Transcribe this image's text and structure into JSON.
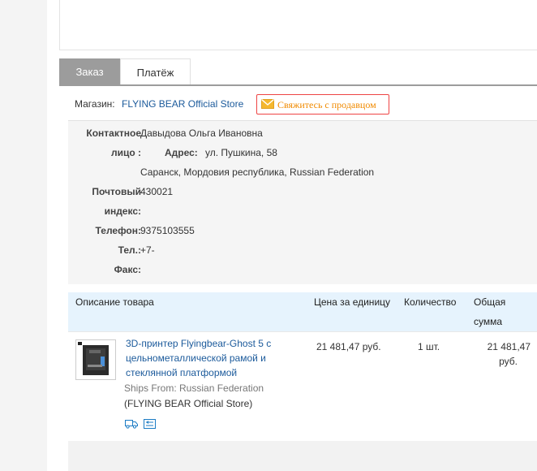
{
  "tabs": {
    "order": "Заказ",
    "payment": "Платёж"
  },
  "store": {
    "label": "Магазин:",
    "name": "FLYING BEAR Official Store",
    "contact_button": "Свяжитесь с продавцом"
  },
  "address": {
    "contact_label_line1": "Контактное",
    "contact_label_line2": "лицо :",
    "contact_value": "Давыдова Ольга Ивановна",
    "address_label": "Адрес:",
    "address_value": "ул. Пушкина, 58",
    "city_line": "Саранск, Мордовия республика, Russian Federation",
    "zip_label_line1": "Почтовый",
    "zip_label_line2": "индекс:",
    "zip_value": "430021",
    "phone_label": "Телефон:",
    "phone_value": "9375103555",
    "tel_label": "Тел.:",
    "tel_value": "+7-",
    "fax_label": "Факс:"
  },
  "table": {
    "headers": {
      "description": "Описание товара",
      "unit_price": "Цена за единицу",
      "quantity": "Количество",
      "total_line1": "Общая",
      "total_line2": "сумма"
    },
    "rows": [
      {
        "title": "3D-принтер Flyingbear-Ghost 5 с цельнометаллической рамой и стеклянной платформой",
        "ships_from": "Ships From: Russian Federation",
        "store": "(FLYING BEAR Official Store)",
        "unit_price": "21 481,47 руб.",
        "quantity": "1 шт.",
        "total_line1": "21 481,47",
        "total_line2": "руб."
      }
    ]
  },
  "colors": {
    "link": "#1b5a9b",
    "contact_text": "#f08a00",
    "contact_border": "#ee4444",
    "tab_active": "#9c9c9c",
    "table_header_bg": "#e6f3fd"
  },
  "icons": [
    "envelope-icon",
    "shipping-truck-icon",
    "order-detail-icon"
  ]
}
